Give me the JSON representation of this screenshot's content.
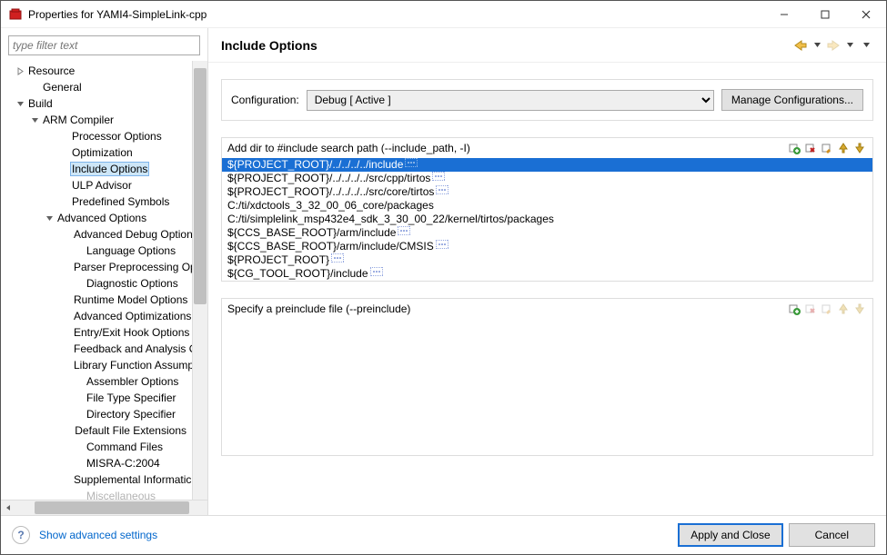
{
  "window": {
    "title": "Properties for YAMI4-SimpleLink-cpp"
  },
  "filter": {
    "placeholder": "type filter text"
  },
  "tree": {
    "items": [
      {
        "label": "Resource",
        "indent": 0,
        "twisty": "closed"
      },
      {
        "label": "General",
        "indent": 1,
        "twisty": ""
      },
      {
        "label": "Build",
        "indent": 0,
        "twisty": "open"
      },
      {
        "label": "ARM Compiler",
        "indent": 1,
        "twisty": "open"
      },
      {
        "label": "Processor Options",
        "indent": 3,
        "twisty": ""
      },
      {
        "label": "Optimization",
        "indent": 3,
        "twisty": ""
      },
      {
        "label": "Include Options",
        "indent": 3,
        "twisty": "",
        "selected": true
      },
      {
        "label": "ULP Advisor",
        "indent": 3,
        "twisty": ""
      },
      {
        "label": "Predefined Symbols",
        "indent": 3,
        "twisty": ""
      },
      {
        "label": "Advanced Options",
        "indent": 2,
        "twisty": "open"
      },
      {
        "label": "Advanced Debug Option",
        "indent": 4,
        "twisty": ""
      },
      {
        "label": "Language Options",
        "indent": 4,
        "twisty": ""
      },
      {
        "label": "Parser Preprocessing Opt",
        "indent": 4,
        "twisty": ""
      },
      {
        "label": "Diagnostic Options",
        "indent": 4,
        "twisty": ""
      },
      {
        "label": "Runtime Model Options",
        "indent": 4,
        "twisty": ""
      },
      {
        "label": "Advanced Optimizations",
        "indent": 4,
        "twisty": ""
      },
      {
        "label": "Entry/Exit Hook Options",
        "indent": 4,
        "twisty": ""
      },
      {
        "label": "Feedback and Analysis O",
        "indent": 4,
        "twisty": ""
      },
      {
        "label": "Library Function Assump",
        "indent": 4,
        "twisty": ""
      },
      {
        "label": "Assembler Options",
        "indent": 4,
        "twisty": ""
      },
      {
        "label": "File Type Specifier",
        "indent": 4,
        "twisty": ""
      },
      {
        "label": "Directory Specifier",
        "indent": 4,
        "twisty": ""
      },
      {
        "label": "Default File Extensions",
        "indent": 4,
        "twisty": ""
      },
      {
        "label": "Command Files",
        "indent": 4,
        "twisty": ""
      },
      {
        "label": "MISRA-C:2004",
        "indent": 4,
        "twisty": ""
      },
      {
        "label": "Supplemental Informatic",
        "indent": 4,
        "twisty": ""
      },
      {
        "label": "Miscellaneous",
        "indent": 4,
        "twisty": "",
        "cut": true
      }
    ]
  },
  "heading": "Include Options",
  "config": {
    "label": "Configuration:",
    "value": "Debug  [ Active ]",
    "manage": "Manage Configurations..."
  },
  "include_group": {
    "title": "Add dir to #include search path (--include_path, -I)",
    "rows": [
      {
        "text": "${PROJECT_ROOT}/../../../../include",
        "ell": true,
        "selected": true
      },
      {
        "text": "${PROJECT_ROOT}/../../../../src/cpp/tirtos",
        "ell": true
      },
      {
        "text": "${PROJECT_ROOT}/../../../../src/core/tirtos",
        "ell": true
      },
      {
        "text": "C:/ti/xdctools_3_32_00_06_core/packages"
      },
      {
        "text": "C:/ti/simplelink_msp432e4_sdk_3_30_00_22/kernel/tirtos/packages"
      },
      {
        "text": "${CCS_BASE_ROOT}/arm/include",
        "ell": true
      },
      {
        "text": "${CCS_BASE_ROOT}/arm/include/CMSIS",
        "ell": true
      },
      {
        "text": "${PROJECT_ROOT}",
        "ell": true
      },
      {
        "text": "${CG_TOOL_ROOT}/include",
        "ell": true
      }
    ]
  },
  "preinclude_group": {
    "title": "Specify a preinclude file (--preinclude)"
  },
  "footer": {
    "advanced": "Show advanced settings",
    "apply": "Apply and Close",
    "cancel": "Cancel"
  }
}
